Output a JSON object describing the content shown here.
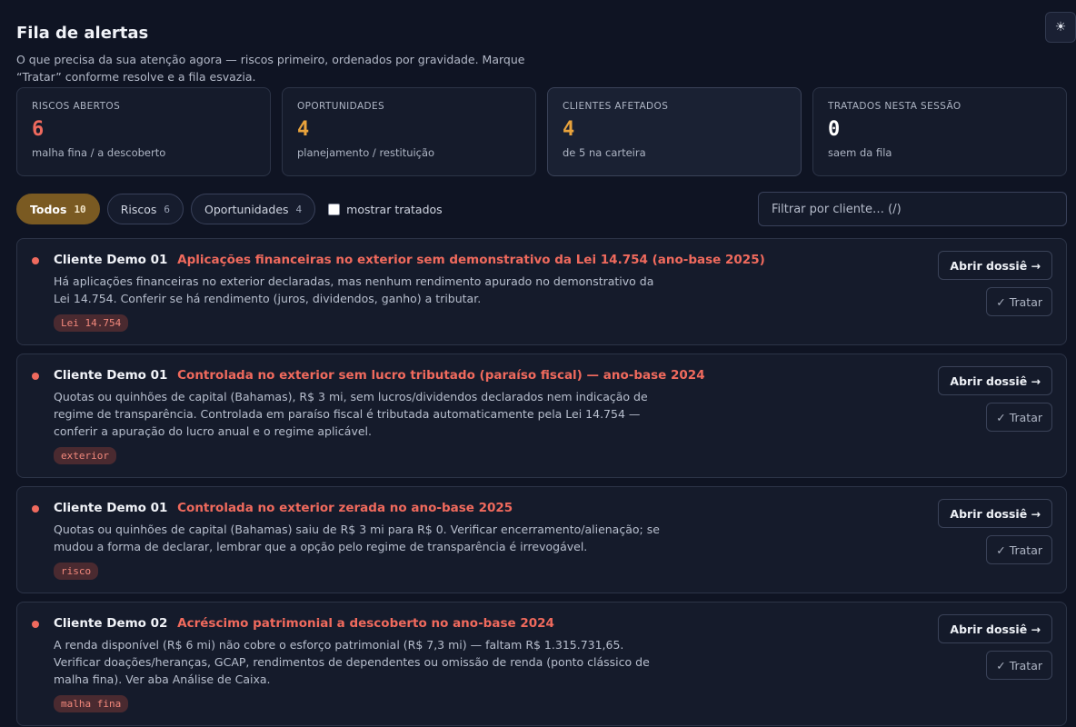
{
  "header": {
    "title": "Fila de alertas",
    "subtitle": "O que precisa da sua atenção agora — riscos primeiro, ordenados por gravidade. Marque “Tratar” conforme resolve e a fila esvazia.",
    "theme_icon": "sun-icon"
  },
  "stats": [
    {
      "label": "Riscos abertos",
      "value": "6",
      "sub": "malha fina / a descoberto",
      "color": "#ef6a5e"
    },
    {
      "label": "Oportunidades",
      "value": "4",
      "sub": "planejamento / restituição",
      "color": "#e9a33c"
    },
    {
      "label": "Clientes afetados",
      "value": "4",
      "sub": "de 5 na carteira",
      "color": "#e9a33c"
    },
    {
      "label": "Tratados nesta sessão",
      "value": "0",
      "sub": "saem da fila",
      "color": "#ffffff"
    }
  ],
  "filters": {
    "tabs": [
      {
        "label": "Todos",
        "count": "10"
      },
      {
        "label": "Riscos",
        "count": "6"
      },
      {
        "label": "Oportunidades",
        "count": "4"
      }
    ],
    "show_treated_label": "mostrar tratados",
    "search_placeholder": "Filtrar por cliente… (/)"
  },
  "alerts": [
    {
      "client": "Cliente Demo 01",
      "title": "Aplicações financeiras no exterior sem demonstrativo da Lei 14.754 (ano-base 2025)",
      "description": "Há aplicações financeiras no exterior declaradas, mas nenhum rendimento apurado no demonstrativo da Lei 14.754. Conferir se há rendimento (juros, dividendos, ganho) a tributar.",
      "tag": "Lei 14.754",
      "open_label": "Abrir dossiê →",
      "treat_label": "✓ Tratar"
    },
    {
      "client": "Cliente Demo 01",
      "title": "Controlada no exterior sem lucro tributado (paraíso fiscal) — ano-base 2024",
      "description": "Quotas ou quinhões de capital (Bahamas), R$ 3 mi, sem lucros/dividendos declarados nem indicação de regime de transparência. Controlada em paraíso fiscal é tributada automaticamente pela Lei 14.754 — conferir a apuração do lucro anual e o regime aplicável.",
      "tag": "exterior",
      "open_label": "Abrir dossiê →",
      "treat_label": "✓ Tratar"
    },
    {
      "client": "Cliente Demo 01",
      "title": "Controlada no exterior zerada no ano-base 2025",
      "description": "Quotas ou quinhões de capital (Bahamas) saiu de R$ 3 mi para R$ 0. Verificar encerramento/alienação; se mudou a forma de declarar, lembrar que a opção pelo regime de transparência é irrevogável.",
      "tag": "risco",
      "open_label": "Abrir dossiê →",
      "treat_label": "✓ Tratar"
    },
    {
      "client": "Cliente Demo 02",
      "title": "Acréscimo patrimonial a descoberto no ano-base 2024",
      "description": "A renda disponível (R$ 6 mi) não cobre o esforço patrimonial (R$ 7,3 mi) — faltam R$ 1.315.731,65. Verificar doações/heranças, GCAP, rendimentos de dependentes ou omissão de renda (ponto clássico de malha fina). Ver aba Análise de Caixa.",
      "tag": "malha fina",
      "open_label": "Abrir dossiê →",
      "treat_label": "✓ Tratar"
    }
  ]
}
